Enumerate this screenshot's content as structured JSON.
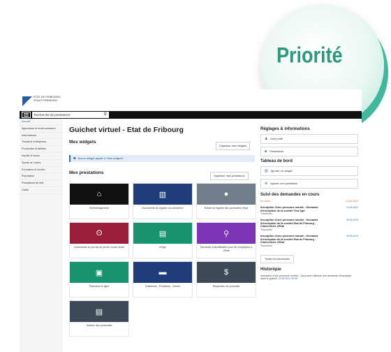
{
  "badge": {
    "text": "Priorité"
  },
  "header": {
    "logo_line1": "ETAT DE FRIBOURG",
    "logo_line2": "STAAT FREIBURG",
    "search_placeholder": "Recherche de prestations"
  },
  "sidebar": {
    "items": [
      {
        "label": "Accueil",
        "active": true
      },
      {
        "label": "Agriculture et environnement"
      },
      {
        "label": "Informations"
      },
      {
        "label": "Travail et entreprises"
      },
      {
        "label": "Poursuites et faillites"
      },
      {
        "label": "Impôts et taxes"
      },
      {
        "label": "Sports et Loisirs"
      },
      {
        "label": "Formation et écoles"
      },
      {
        "label": "Population"
      },
      {
        "label": "Prestations de test"
      },
      {
        "label": "Outils"
      }
    ]
  },
  "main": {
    "title": "Guichet virtuel - Etat de Fribourg",
    "widgets_title": "Mes widgets",
    "organize_widgets": "Organiser mes widgets",
    "info": "Aucun widget ajouté à \"Mes widgets\"",
    "prestations_title": "Mes prestations",
    "organize_prestations": "Organiser mes prestations",
    "tiles": [
      {
        "label": "eDéménagement",
        "icon": "home-icon",
        "glyph": "⌂",
        "color": "#111111"
      },
      {
        "label": "Documents du registre du commerce",
        "icon": "book-icon",
        "glyph": "▥",
        "color": "#1f3d7a"
      },
      {
        "label": "Extrait du registre des poursuites (Test)",
        "icon": "person-icon",
        "glyph": "●",
        "color": "#6f7e8a"
      },
      {
        "label": "Commande du permis de pêche courte durée",
        "icon": "hook-icon",
        "glyph": "ʘ",
        "color": "#9b1f3a"
      },
      {
        "label": "eSign",
        "icon": "document-icon",
        "glyph": "▤",
        "color": "#17936e"
      },
      {
        "label": "Demande d'identification pour les employées-s d'Etat",
        "icon": "search-person-icon",
        "glyph": "⚲",
        "color": "#7b35b5"
      },
      {
        "label": "Paiement en ligne",
        "icon": "cart-icon",
        "glyph": "▣",
        "color": "#17936e"
      },
      {
        "label": "Guidelines - Prestation - interne",
        "icon": "truck-icon",
        "glyph": "▬",
        "color": "#1f3d7a"
      },
      {
        "label": "Réquisition de poursuite",
        "icon": "file-dollar-icon",
        "glyph": "$",
        "color": "#3b4a56"
      },
      {
        "label": "Gestion des poursuites",
        "icon": "file-icon",
        "glyph": "▤",
        "color": "#3b4a56"
      }
    ]
  },
  "right": {
    "settings_title": "Réglages & informations",
    "profile": "Mon profil",
    "prestations": "Prestations",
    "dashboard_title": "Tableau de bord",
    "add_widget": "Ajouter un widget",
    "add_prestation": "Ajouter une prestation",
    "follow_title": "Suivi des demandes en cours",
    "follow_head_left": "En cours",
    "follow_head_right": "13.06.2022",
    "follow_items": [
      {
        "title": "Inscription d'une personne morale - Demande d'inscription de la société Test Agri",
        "date": "13.06.2022",
        "status": "Transmise"
      },
      {
        "title": "Inscription d'une personne morale - Demande d'inscription de la société Etat de Fribourg - Chancellerie d'Etat",
        "date": "09.06.2022",
        "status": "Transmise"
      },
      {
        "title": "Inscription d'une personne morale - Demande d'inscription de la société Etat de Fribourg - Chancellerie d'Etat",
        "date": "09.06.2022",
        "status": "Transmise"
      }
    ],
    "all_requests": "Toutes les demandes",
    "history_title": "Historique",
    "history_text": "Inscription d'une personne morale - Vous avez effectué une demande d'inscription dans le guichet",
    "history_date": "13.06.2022 09:06"
  },
  "colors": {
    "accent": "#2a6db5",
    "badge_text": "#2a9a7a",
    "badge_ring": "#3fb89c"
  }
}
